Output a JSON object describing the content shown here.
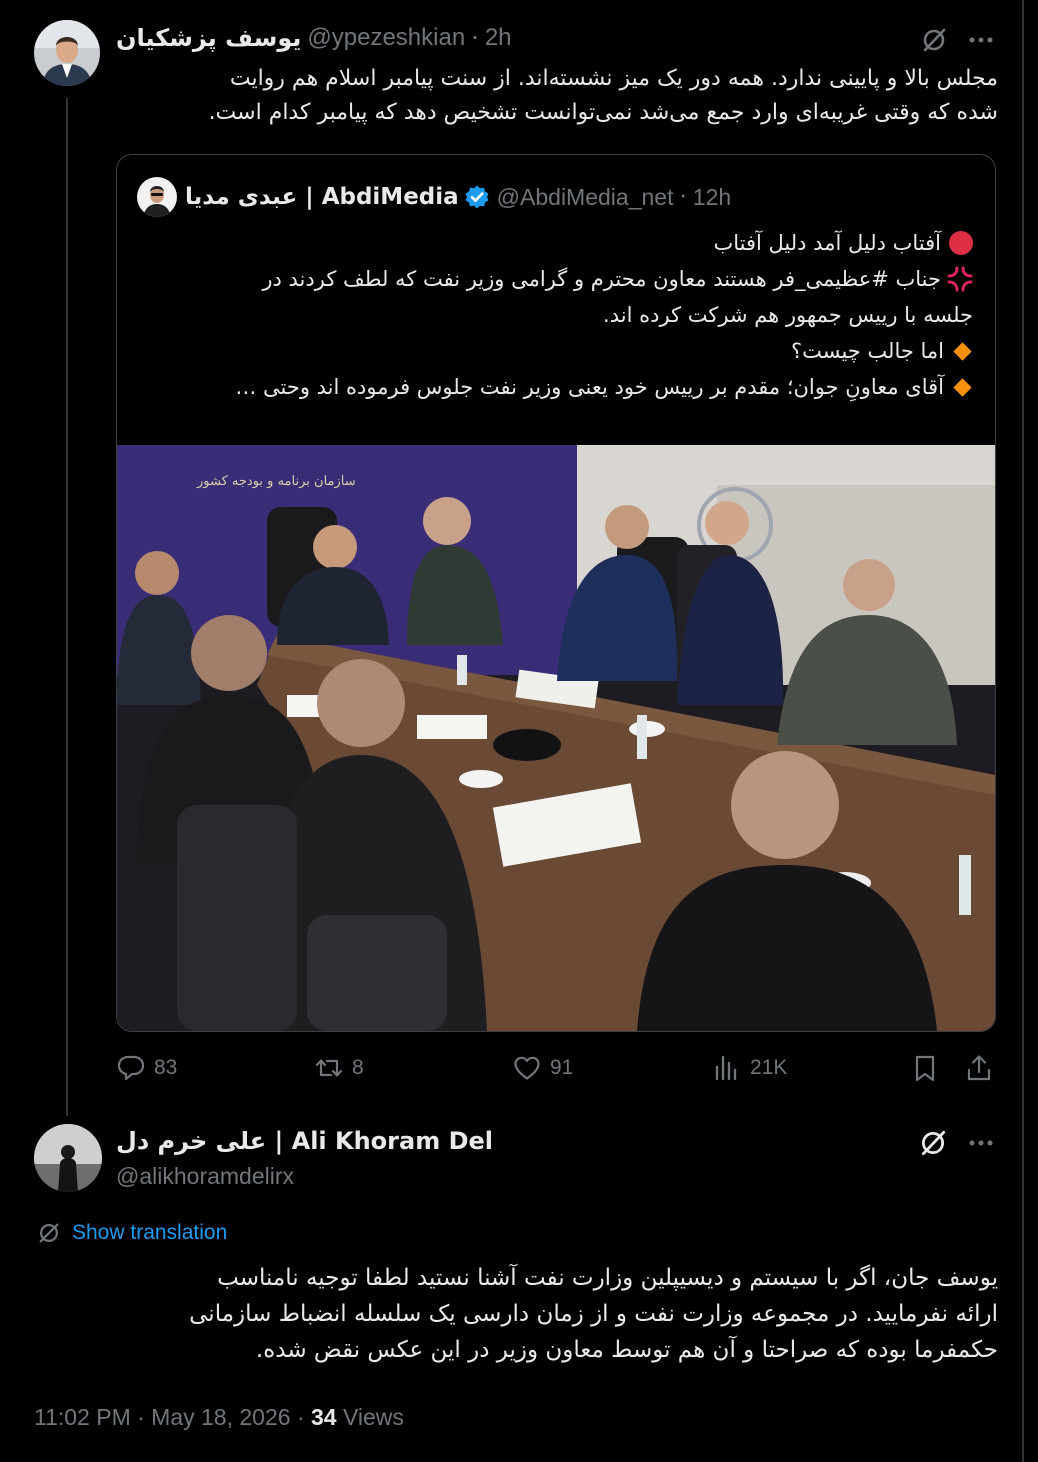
{
  "main_tweet": {
    "display_name": "یوسف پزشکیان",
    "handle": "@ypezeshkian",
    "time": "2h",
    "text_lines": [
      "مجلس بالا و پایینی ندارد. همه دور یک میز نشسته‌اند. از سنت پیامبر اسلام هم روایت",
      "شده که وقتی غریبه‌ای وارد جمع می‌شد نمی‌توانست تشخیص دهد که پیامبر کدام است."
    ]
  },
  "quoted_tweet": {
    "display_name": "عبدی مدیا | AbdiMedia",
    "verified": true,
    "handle": "@AbdiMedia_net",
    "time": "12h",
    "lines": [
      {
        "icon": "red-circle-icon",
        "text": "آفتاب دلیل آمد دلیل آفتاب"
      },
      {
        "icon": "anger-symbol-icon",
        "text": "جناب #عظیمی_فر هستند معاون محترم و گرامی وزیر نفت که لطف کردند در"
      },
      {
        "icon": "",
        "text": "جلسه با رییس جمهور هم شرکت کرده اند."
      },
      {
        "icon": "orange-diamond-icon",
        "text": "اما جالب چیست؟"
      },
      {
        "icon": "orange-diamond-icon",
        "text": "آقای معاونِ جوان؛ مقدم بر رییس خود یعنی وزیر نفت جلوس فرموده اند وحتی …"
      }
    ],
    "photo_caption": "سازمان برنامه و بودجه کشور"
  },
  "actions": {
    "replies": "83",
    "reposts": "8",
    "likes": "91",
    "views": "21K"
  },
  "reply": {
    "display_name": "علی خرم دل | Ali Khoram Del",
    "handle": "@alikhoramdelirx",
    "show_translation": "Show translation",
    "text_lines": [
      "یوسف جان، اگر با سیستم و دیسیپلین وزارت نفت آشنا نستید لطفا توجیه نامناسب",
      "ارائه نفرمایید. در مجموعه وزارت نفت و از زمان دارسی یک سلسله انضباط سازمانی",
      "حکمفرما بوده که صراحتا و آن هم توسط معاون وزیر در این عکس نقض شده."
    ],
    "timestamp": "11:02 PM · May 18, 2026 · ",
    "views_count": "34",
    "views_label": " Views"
  },
  "colors": {
    "background": "#000000",
    "text": "#e7e9ea",
    "muted": "#71767b",
    "link": "#1d9bf0",
    "verified": "#1d9bf0",
    "border": "#3e4144"
  }
}
